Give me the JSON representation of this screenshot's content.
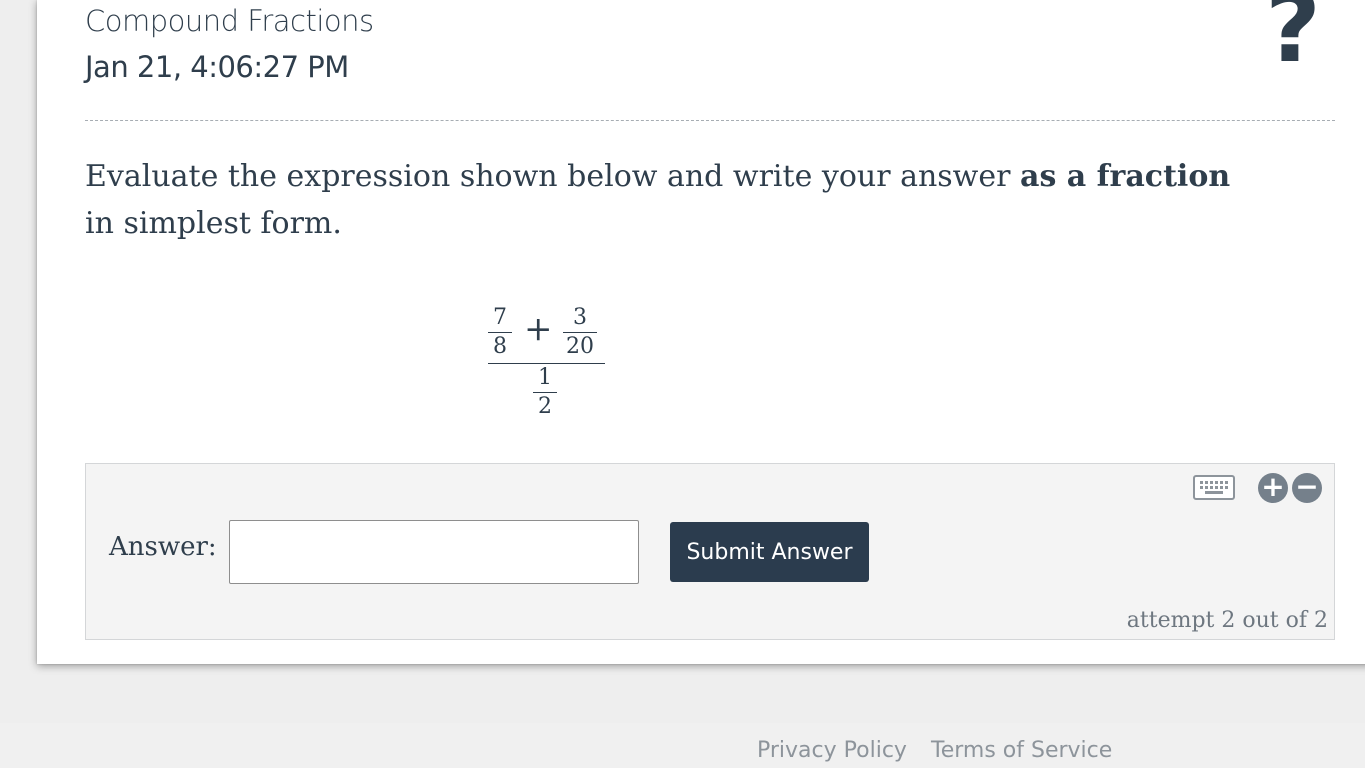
{
  "header": {
    "topic_title": "Compound Fractions",
    "timestamp": "Jan 21, 4:06:27 PM",
    "help_icon_glyph": "?",
    "help_icon": "question-mark-icon"
  },
  "question": {
    "text_before": "Evaluate the expression shown below and write your answer ",
    "text_bold": "as a fraction",
    "text_after": " in simplest form."
  },
  "expression": {
    "top_left": {
      "numerator": "7",
      "denominator": "8"
    },
    "operator": "+",
    "top_right": {
      "numerator": "3",
      "denominator": "20"
    },
    "bottom": {
      "numerator": "1",
      "denominator": "2"
    }
  },
  "answer_panel": {
    "label": "Answer:",
    "input_value": "",
    "input_placeholder": "",
    "submit_label": "Submit Answer",
    "attempt_text": "attempt 2 out of 2",
    "icons": {
      "keyboard": "keyboard-icon",
      "zoom_in": "plus-circle-icon",
      "zoom_out": "minus-circle-icon"
    },
    "zoom_in_glyph": "+",
    "zoom_out_glyph": "−"
  },
  "footer": {
    "privacy_label": "Privacy Policy",
    "terms_label": "Terms of Service"
  },
  "colors": {
    "text": "#2f3e4c",
    "button": "#2b3c4e",
    "panel_bg": "#f4f4f4",
    "page_bg": "#eeeeee",
    "muted": "#8d949b"
  }
}
